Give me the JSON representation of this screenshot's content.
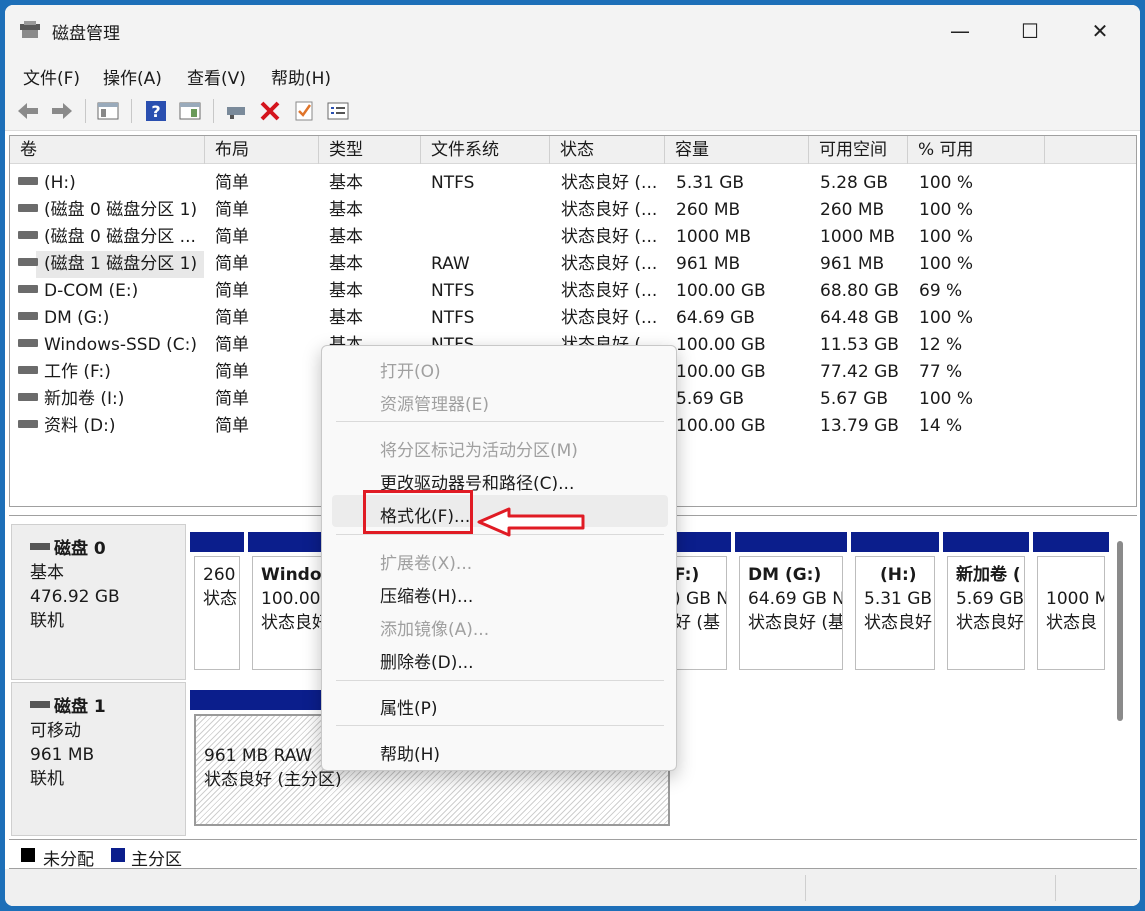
{
  "window": {
    "title": "磁盘管理",
    "icon": "disk-management-icon"
  },
  "window_controls": {
    "minimize": "—",
    "maximize": "☐",
    "close": "✕"
  },
  "menu": [
    "文件(F)",
    "操作(A)",
    "查看(V)",
    "帮助(H)"
  ],
  "toolbar_icons": [
    "back-arrow-icon",
    "forward-arrow-icon",
    "console-tree-icon",
    "help-icon",
    "properties-icon",
    "connect-icon",
    "delete-icon",
    "check-icon",
    "list-icon"
  ],
  "volume_list": {
    "columns": [
      "卷",
      "布局",
      "类型",
      "文件系统",
      "状态",
      "容量",
      "可用空间",
      "% 可用"
    ],
    "rows": [
      [
        "(H:)",
        "简单",
        "基本",
        "NTFS",
        "状态良好 (...",
        "5.31 GB",
        "5.28 GB",
        "100 %"
      ],
      [
        "(磁盘 0 磁盘分区 1)",
        "简单",
        "基本",
        "",
        "状态良好 (...",
        "260 MB",
        "260 MB",
        "100 %"
      ],
      [
        "(磁盘 0 磁盘分区 ...",
        "简单",
        "基本",
        "",
        "状态良好 (...",
        "1000 MB",
        "1000 MB",
        "100 %"
      ],
      [
        "(磁盘 1 磁盘分区 1)",
        "简单",
        "基本",
        "RAW",
        "状态良好 (...",
        "961 MB",
        "961 MB",
        "100 %"
      ],
      [
        "D-COM (E:)",
        "简单",
        "基本",
        "NTFS",
        "状态良好 (...",
        "100.00 GB",
        "68.80 GB",
        "69 %"
      ],
      [
        "DM (G:)",
        "简单",
        "基本",
        "NTFS",
        "状态良好 (...",
        "64.69 GB",
        "64.48 GB",
        "100 %"
      ],
      [
        "Windows-SSD (C:)",
        "简单",
        "基本",
        "NTFS",
        "状态良好 (...",
        "100.00 GB",
        "11.53 GB",
        "12 %"
      ],
      [
        "工作 (F:)",
        "简单",
        "",
        "",
        "",
        "100.00 GB",
        "77.42 GB",
        "77 %"
      ],
      [
        "新加卷 (I:)",
        "简单",
        "",
        "",
        "",
        "5.69 GB",
        "5.67 GB",
        "100 %"
      ],
      [
        "资料 (D:)",
        "简单",
        "",
        "",
        "",
        "100.00 GB",
        "13.79 GB",
        "14 %"
      ]
    ]
  },
  "disks": [
    {
      "name": "磁盘 0",
      "type": "基本",
      "size": "476.92 GB",
      "status": "联机",
      "partitions": [
        {
          "name": "",
          "line1": "260",
          "line2": "状态"
        },
        {
          "name": "Windo",
          "line1": "100.00",
          "line2": "状态良好"
        },
        {
          "name": "F:)",
          "line1": ") GB N",
          "line2": "好 (基"
        },
        {
          "name": "DM  (G:)",
          "line1": "64.69 GB N",
          "line2": "状态良好 (基"
        },
        {
          "name": "(H:)",
          "line1": "5.31 GB",
          "line2": "状态良好"
        },
        {
          "name": "新加卷 (",
          "line1": "5.69 GB",
          "line2": "状态良好"
        },
        {
          "name": "",
          "line1": "1000 M",
          "line2": "状态良"
        }
      ]
    },
    {
      "name": "磁盘 1",
      "type": "可移动",
      "size": "961 MB",
      "status": "联机",
      "partitions": [
        {
          "name": "",
          "line1": "961 MB RAW",
          "line2": "状态良好 (主分区)"
        }
      ]
    }
  ],
  "legend": [
    {
      "label": "未分配",
      "color": "#000000"
    },
    {
      "label": "主分区",
      "color": "#0b1e8c"
    }
  ],
  "context_menu": {
    "items": [
      {
        "label": "打开(O)",
        "enabled": false
      },
      {
        "label": "资源管理器(E)",
        "enabled": false
      },
      {
        "label": "将分区标记为活动分区(M)",
        "enabled": false
      },
      {
        "label": "更改驱动器号和路径(C)...",
        "enabled": true
      },
      {
        "label": "格式化(F)...",
        "enabled": true,
        "highlighted": true
      },
      {
        "label": "扩展卷(X)...",
        "enabled": false
      },
      {
        "label": "压缩卷(H)...",
        "enabled": true
      },
      {
        "label": "添加镜像(A)...",
        "enabled": false
      },
      {
        "label": "删除卷(D)...",
        "enabled": true
      },
      {
        "label": "属性(P)",
        "enabled": true
      },
      {
        "label": "帮助(H)",
        "enabled": true
      }
    ]
  },
  "annotation_colors": {
    "box": "#e01b24",
    "arrow": "#e01b24"
  }
}
